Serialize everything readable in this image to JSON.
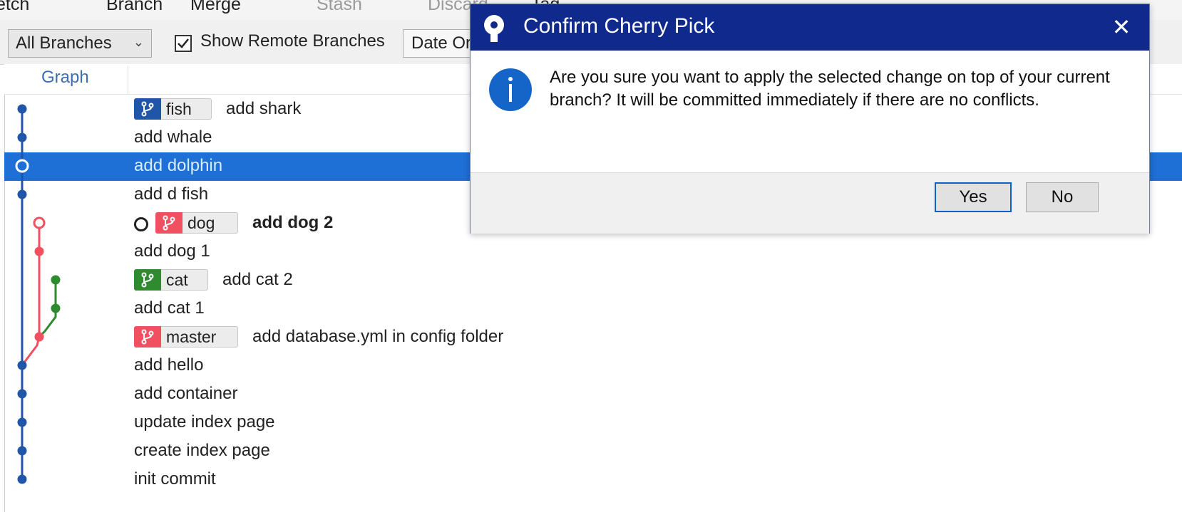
{
  "toolbar": {
    "items": [
      {
        "label": "etch",
        "dim": false
      },
      {
        "label": "Branch",
        "dim": false
      },
      {
        "label": "Merge",
        "dim": false
      },
      {
        "label": "Stash",
        "dim": true
      },
      {
        "label": "Discard",
        "dim": true
      },
      {
        "label": "Tag",
        "dim": false
      }
    ]
  },
  "filter": {
    "branch_select": "All Branches",
    "show_remote_label": "Show Remote Branches",
    "show_remote_checked": true,
    "sort_select": "Date Order"
  },
  "columns": {
    "graph": "Graph"
  },
  "commits": [
    {
      "message": "add shark",
      "tag": "fish",
      "tag_color": "#1f56a8",
      "bold": false,
      "selected": false
    },
    {
      "message": "add whale",
      "tag": null,
      "bold": false,
      "selected": false
    },
    {
      "message": "add dolphin",
      "tag": null,
      "bold": false,
      "selected": true
    },
    {
      "message": "add        d fish",
      "tag": null,
      "bold": false,
      "selected": false
    },
    {
      "message": "add dog 2",
      "tag": "dog",
      "tag_color": "#f0505f",
      "bold": true,
      "selected": false,
      "head": true
    },
    {
      "message": "add dog 1",
      "tag": null,
      "bold": false,
      "selected": false
    },
    {
      "message": "add cat 2",
      "tag": "cat",
      "tag_color": "#2e8b2e",
      "bold": false,
      "selected": false
    },
    {
      "message": "add cat 1",
      "tag": null,
      "bold": false,
      "selected": false
    },
    {
      "message": "add database.yml in config folder",
      "tag": "master",
      "tag_color": "#f0505f",
      "bold": false,
      "selected": false
    },
    {
      "message": "add hello",
      "tag": null,
      "bold": false,
      "selected": false
    },
    {
      "message": "add container",
      "tag": null,
      "bold": false,
      "selected": false
    },
    {
      "message": "update index page",
      "tag": null,
      "bold": false,
      "selected": false
    },
    {
      "message": "create index page",
      "tag": null,
      "bold": false,
      "selected": false
    },
    {
      "message": "init commit",
      "tag": null,
      "bold": false,
      "selected": false
    }
  ],
  "graph_colors": {
    "blue": "#1f56a8",
    "red": "#f0505f",
    "green": "#2e8b2e",
    "selection": "#1e6fd6"
  },
  "dialog": {
    "title": "Confirm Cherry Pick",
    "close_glyph": "✕",
    "message": "Are you sure you want to apply the selected change on top of your current branch? It will be committed immediately if there are no conflicts.",
    "yes_label": "Yes",
    "no_label": "No",
    "title_bar_color": "#0f2a8c",
    "icon": "info-icon"
  }
}
